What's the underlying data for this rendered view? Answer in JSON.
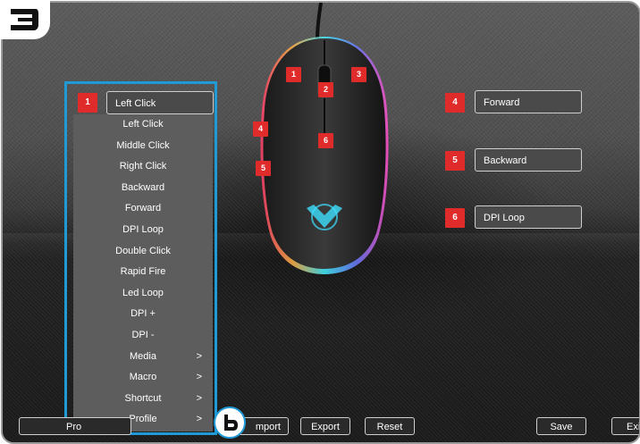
{
  "step_badge": "3",
  "mouse": {
    "markers": [
      "1",
      "2",
      "3",
      "4",
      "5",
      "6"
    ]
  },
  "button1": {
    "number": "1",
    "value": "Left Click"
  },
  "dropdown": {
    "items": [
      {
        "label": "Left Click",
        "submenu": false
      },
      {
        "label": "Middle Click",
        "submenu": false
      },
      {
        "label": "Right Click",
        "submenu": false
      },
      {
        "label": "Backward",
        "submenu": false
      },
      {
        "label": "Forward",
        "submenu": false
      },
      {
        "label": "DPI Loop",
        "submenu": false
      },
      {
        "label": "Double Click",
        "submenu": false
      },
      {
        "label": "Rapid Fire",
        "submenu": false
      },
      {
        "label": "Led Loop",
        "submenu": false
      },
      {
        "label": "DPI +",
        "submenu": false
      },
      {
        "label": "DPI -",
        "submenu": false
      },
      {
        "label": "Media",
        "submenu": true
      },
      {
        "label": "Macro",
        "submenu": true
      },
      {
        "label": "Shortcut",
        "submenu": true
      },
      {
        "label": "Profile",
        "submenu": true
      }
    ],
    "chevron": ">"
  },
  "right_buttons": [
    {
      "number": "4",
      "value": "Forward"
    },
    {
      "number": "5",
      "value": "Backward"
    },
    {
      "number": "6",
      "value": "DPI Loop"
    }
  ],
  "bottom": {
    "profile_partial": "Pro",
    "import_partial": "mport",
    "export": "Export",
    "reset": "Reset",
    "save": "Save",
    "exit_partial": "Exi"
  },
  "callout_b": "b",
  "colors": {
    "accent_blue": "#1f9ad6",
    "marker_red": "#e02b2b"
  }
}
